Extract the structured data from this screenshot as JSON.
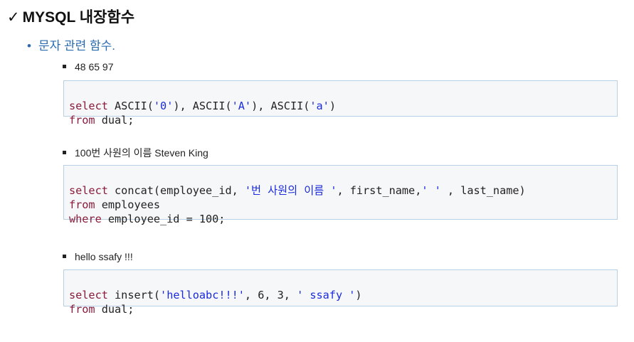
{
  "header": {
    "check": "✓",
    "title": "MYSQL 내장함수"
  },
  "section": {
    "bullet": "•",
    "subtitle": "문자 관련 함수."
  },
  "examples": [
    {
      "label": "48 65 97",
      "line1": {
        "kw": "select",
        "a": "ASCII(",
        "s1": "'0'",
        "b": "), ASCII(",
        "s2": "'A'",
        "c": "), ASCII(",
        "s3": "'a'",
        "d": ")"
      },
      "line2": {
        "kw": "from",
        "rest": " dual;"
      }
    },
    {
      "label": "100번 사원의 이름 Steven King",
      "line1": {
        "kw": "select",
        "a": "concat(employee_id, ",
        "s1": "'번 사원의 이름 '",
        "b": ", first_name,",
        "s2": "' '",
        "c": " , last_name)"
      },
      "line2": {
        "kw": "from",
        "rest": " employees"
      },
      "line3": {
        "kw": "where",
        "rest": " employee_id = 100;"
      }
    },
    {
      "label": "hello ssafy !!!",
      "line1": {
        "kw": "select",
        "a": "insert(",
        "s1": "'helloabc!!!'",
        "b": ", 6, 3, ",
        "s2": "' ssafy '",
        "c": ")"
      },
      "line2": {
        "kw": "from",
        "rest": " dual;"
      }
    }
  ]
}
